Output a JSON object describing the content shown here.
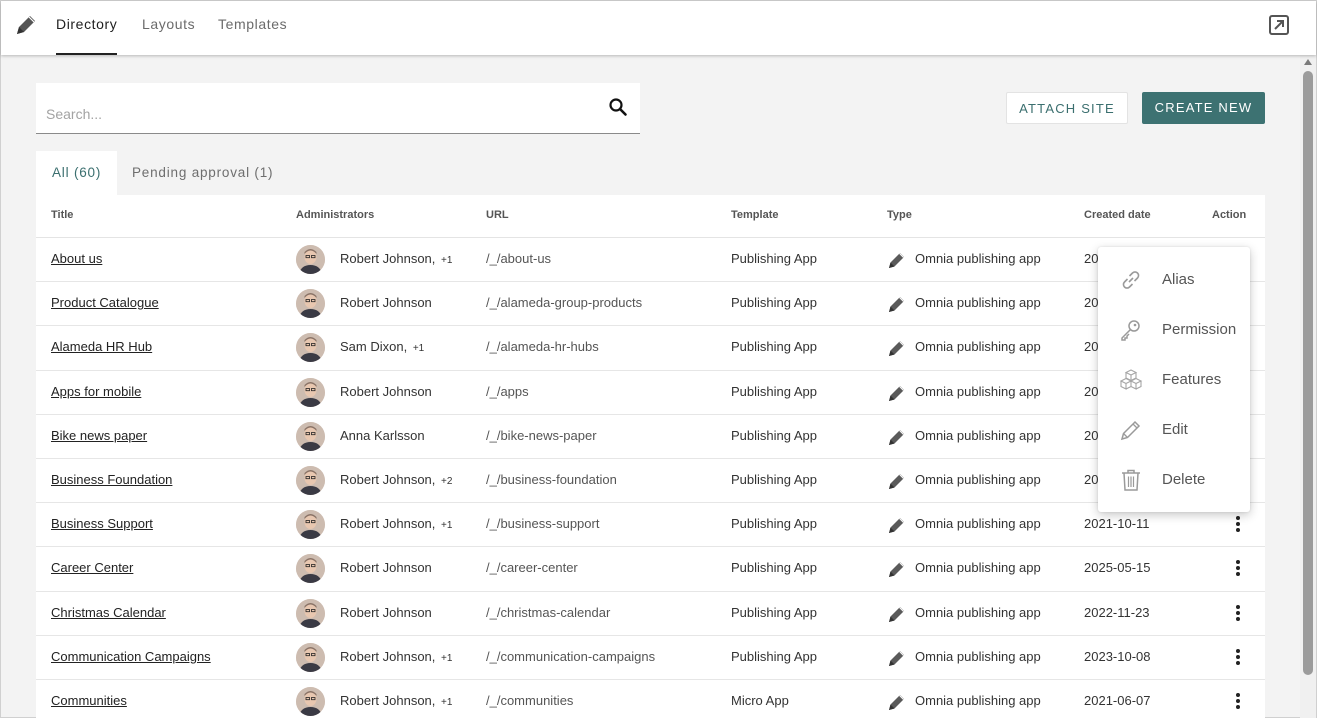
{
  "nav": {
    "tabs": [
      {
        "label": "Directory"
      },
      {
        "label": "Layouts"
      },
      {
        "label": "Templates"
      }
    ]
  },
  "search": {
    "placeholder": "Search...",
    "value": ""
  },
  "actions": {
    "attach_label": "ATTACH SITE",
    "create_label": "CREATE NEW"
  },
  "filters": [
    {
      "label": "All (60)"
    },
    {
      "label": "Pending approval (1)"
    }
  ],
  "table": {
    "headers": {
      "title": "Title",
      "administrators": "Administrators",
      "url": "URL",
      "template": "Template",
      "type": "Type",
      "created": "Created date",
      "action": "Action"
    },
    "rows": [
      {
        "title": "About us",
        "admin": "Robert Johnson,",
        "more": "+1",
        "url": "/_/about-us",
        "template": "Publishing App",
        "type": "Omnia publishing app",
        "date": "20"
      },
      {
        "title": "Product Catalogue",
        "admin": "Robert Johnson",
        "more": "",
        "url": "/_/alameda-group-products",
        "template": "Publishing App",
        "type": "Omnia publishing app",
        "date": "20"
      },
      {
        "title": "Alameda HR Hub",
        "admin": "Sam Dixon,",
        "more": "+1",
        "url": "/_/alameda-hr-hubs",
        "template": "Publishing App",
        "type": "Omnia publishing app",
        "date": "20"
      },
      {
        "title": "Apps for mobile",
        "admin": "Robert Johnson",
        "more": "",
        "url": "/_/apps",
        "template": "Publishing App",
        "type": "Omnia publishing app",
        "date": "20"
      },
      {
        "title": "Bike news paper",
        "admin": "Anna Karlsson",
        "more": "",
        "url": "/_/bike-news-paper",
        "template": "Publishing App",
        "type": "Omnia publishing app",
        "date": "20"
      },
      {
        "title": "Business Foundation",
        "admin": "Robert Johnson,",
        "more": "+2",
        "url": "/_/business-foundation",
        "template": "Publishing App",
        "type": "Omnia publishing app",
        "date": "20"
      },
      {
        "title": "Business Support",
        "admin": "Robert Johnson,",
        "more": "+1",
        "url": "/_/business-support",
        "template": "Publishing App",
        "type": "Omnia publishing app",
        "date": "2021-10-11"
      },
      {
        "title": "Career Center",
        "admin": "Robert Johnson",
        "more": "",
        "url": "/_/career-center",
        "template": "Publishing App",
        "type": "Omnia publishing app",
        "date": "2025-05-15"
      },
      {
        "title": "Christmas Calendar",
        "admin": "Robert Johnson",
        "more": "",
        "url": "/_/christmas-calendar",
        "template": "Publishing App",
        "type": "Omnia publishing app",
        "date": "2022-11-23"
      },
      {
        "title": "Communication Campaigns",
        "admin": "Robert Johnson,",
        "more": "+1",
        "url": "/_/communication-campaigns",
        "template": "Publishing App",
        "type": "Omnia publishing app",
        "date": "2023-10-08"
      },
      {
        "title": "Communities",
        "admin": "Robert Johnson,",
        "more": "+1",
        "url": "/_/communities",
        "template": "Micro App",
        "type": "Omnia publishing app",
        "date": "2021-06-07"
      }
    ]
  },
  "context_menu": {
    "items": [
      {
        "label": "Alias",
        "icon": "link-icon"
      },
      {
        "label": "Permission",
        "icon": "key-icon"
      },
      {
        "label": "Features",
        "icon": "cubes-icon"
      },
      {
        "label": "Edit",
        "icon": "pencil-icon"
      },
      {
        "label": "Delete",
        "icon": "trash-icon"
      }
    ]
  },
  "colors": {
    "accent": "#3d7272",
    "menu_icon": "#9a9a9a"
  }
}
